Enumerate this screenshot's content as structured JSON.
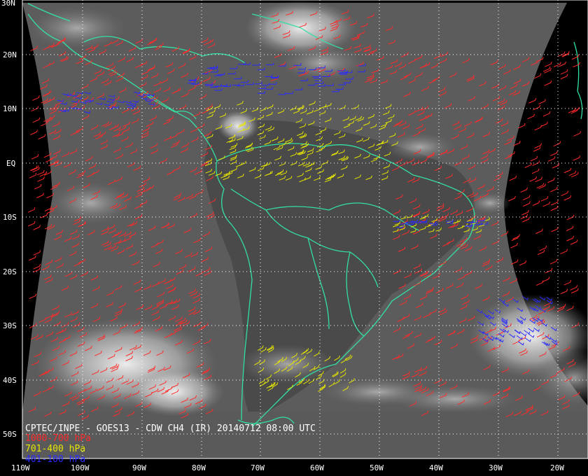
{
  "title": "CPTEC/INPE - GOES13 - CDW CH4 (IR) 20140712 08:00 UTC",
  "legend": [
    {
      "label": "1000-700 hPa",
      "color": "#ff2a2a"
    },
    {
      "label": "701-400 hPa",
      "color": "#e6e600"
    },
    {
      "label": "401-100 hPa",
      "color": "#2a2aff"
    }
  ],
  "lat_labels": [
    "30N",
    "20N",
    "10N",
    "EQ",
    "10S",
    "20S",
    "30S",
    "40S",
    "50S"
  ],
  "lon_labels": [
    "110W",
    "100W",
    "90W",
    "80W",
    "70W",
    "60W",
    "50W",
    "40W",
    "30W",
    "20W"
  ],
  "coastline_color": "#33e0a0",
  "grid_color": "#ffffff"
}
